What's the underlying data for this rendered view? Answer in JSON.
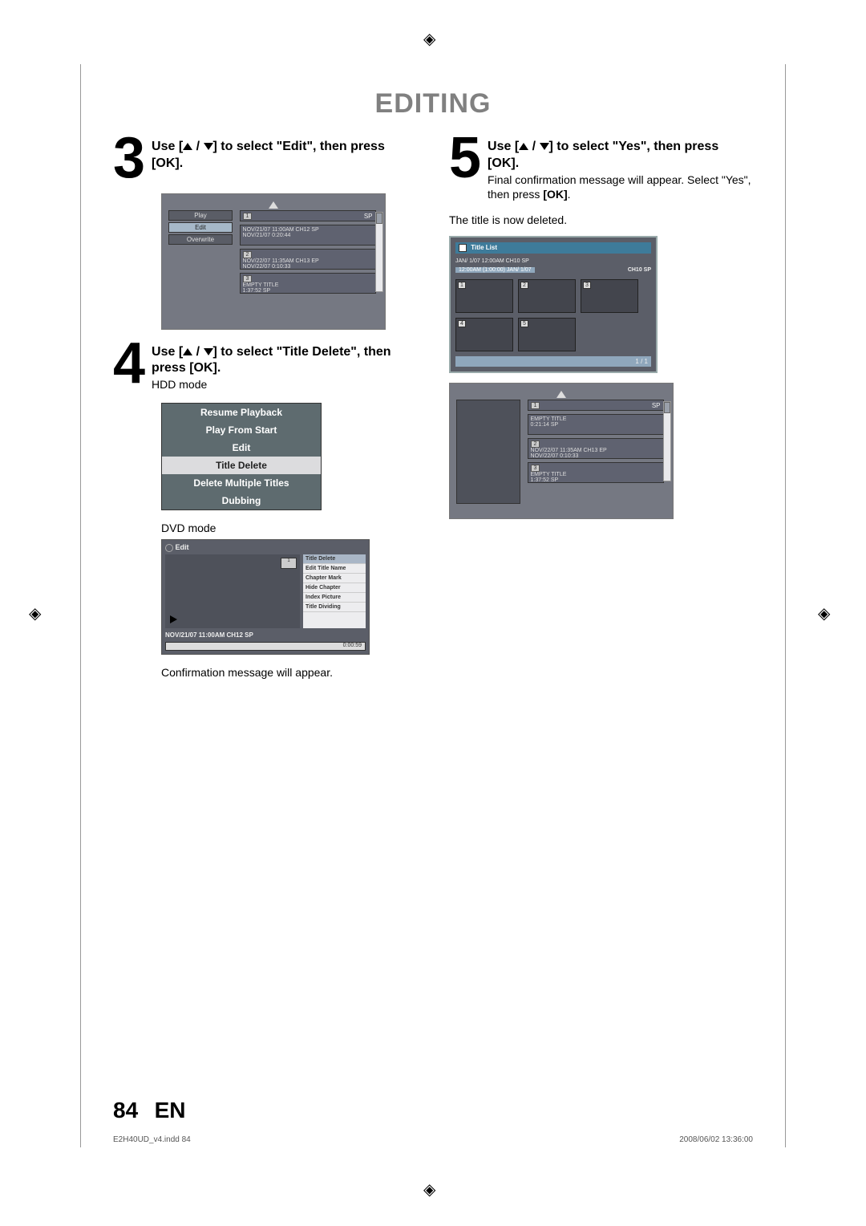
{
  "section_title": "EDITING",
  "steps": {
    "s3": {
      "num": "3",
      "text_before": "Use [",
      "text_mid": " / ",
      "text_after": "] to select \"Edit\", then press [OK]."
    },
    "s4": {
      "num": "4",
      "text_before": "Use [",
      "text_mid": " / ",
      "text_after": "] to select \"Title Delete\", then press [OK].",
      "sub": "HDD mode"
    },
    "s5": {
      "num": "5",
      "text_before": "Use [",
      "text_mid": " / ",
      "text_after": "] to select \"Yes\", then press [OK].",
      "desc1": "Final confirmation message will appear. Select \"Yes\", then press ",
      "desc_bold": "[OK]",
      "desc2": ".",
      "deleted": "The title is now deleted."
    }
  },
  "dvd_caption": "DVD mode",
  "confirm_msg": "Confirmation message will appear.",
  "screenshot3": {
    "tabs": [
      "Play",
      "Edit",
      "Overwrite"
    ],
    "sp": "SP",
    "items": [
      {
        "n": "1",
        "l1": "NOV/21/07  11:00AM CH12  SP",
        "l2": "NOV/21/07   0:20:44"
      },
      {
        "n": "2",
        "l1": "NOV/22/07  11:35AM CH13  EP",
        "l2": "NOV/22/07   0:10:33"
      },
      {
        "n": "3",
        "l1": "EMPTY TITLE",
        "l2": "1:37:52  SP"
      }
    ]
  },
  "hdd_menu": {
    "items": [
      "Resume Playback",
      "Play From Start",
      "Edit",
      "Title Delete",
      "Delete Multiple Titles",
      "Dubbing"
    ],
    "selected": 3
  },
  "dvd_edit": {
    "header": "Edit",
    "thumb": "1",
    "menu": [
      "Title Delete",
      "Edit Title Name",
      "Chapter Mark",
      "Hide Chapter",
      "Index Picture",
      "Title Dividing"
    ],
    "info": "NOV/21/07 11:00AM CH12 SP",
    "time": "0:00:59"
  },
  "titlelist": {
    "header": "Title List",
    "meta_line": "JAN/ 1/07 12:00AM  CH10  SP",
    "bar": "12:00AM (1:00:00)   JAN/  1/07",
    "bar_right": "CH10   SP",
    "cells": [
      "1",
      "2",
      "3",
      "4",
      "5"
    ],
    "page": "1 / 1"
  },
  "screenshot5b": {
    "sp": "SP",
    "items": [
      {
        "n": "1",
        "l1": "EMPTY TITLE",
        "l2": "0:21:14  SP"
      },
      {
        "n": "2",
        "l1": "NOV/22/07  11:35AM CH13  EP",
        "l2": "NOV/22/07   0:10:33"
      },
      {
        "n": "3",
        "l1": "EMPTY TITLE",
        "l2": "1:37:52  SP"
      }
    ]
  },
  "footer": {
    "page": "84",
    "lang": "EN"
  },
  "printmeta": {
    "file": "E2H40UD_v4.indd   84",
    "ts": "2008/06/02   13:36:00"
  }
}
